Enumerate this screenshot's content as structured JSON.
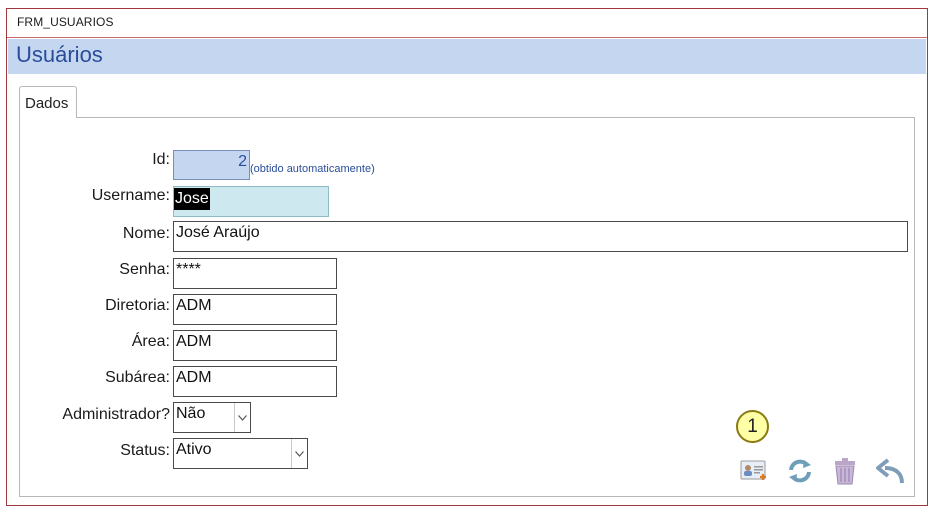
{
  "window": {
    "title": "FRM_USUARIOS"
  },
  "header": {
    "title": "Usuários"
  },
  "tabs": [
    {
      "label": "Dados"
    }
  ],
  "form": {
    "id": {
      "label": "Id:",
      "value": "2",
      "hint": "(obtido automaticamente)"
    },
    "username": {
      "label": "Username:",
      "value": "Jose"
    },
    "nome": {
      "label": "Nome:",
      "value": "José Araújo"
    },
    "senha": {
      "label": "Senha:",
      "value": "****"
    },
    "diretoria": {
      "label": "Diretoria:",
      "value": "ADM"
    },
    "area": {
      "label": "Área:",
      "value": "ADM"
    },
    "subarea": {
      "label": "Subárea:",
      "value": "ADM"
    },
    "administrador": {
      "label": "Administrador?",
      "value": "Não"
    },
    "status": {
      "label": "Status:",
      "value": "Ativo"
    }
  },
  "callout": {
    "number": "1"
  },
  "actions": [
    {
      "icon": "new-user-card-icon"
    },
    {
      "icon": "refresh-icon"
    },
    {
      "icon": "trash-icon"
    },
    {
      "icon": "undo-icon"
    }
  ],
  "colors": {
    "border_accent": "#a0393f",
    "header_band": "#c5d7f0",
    "header_text": "#2a4d9b",
    "username_bg": "#cde8ee",
    "callout_bg": "#ffffa6"
  }
}
